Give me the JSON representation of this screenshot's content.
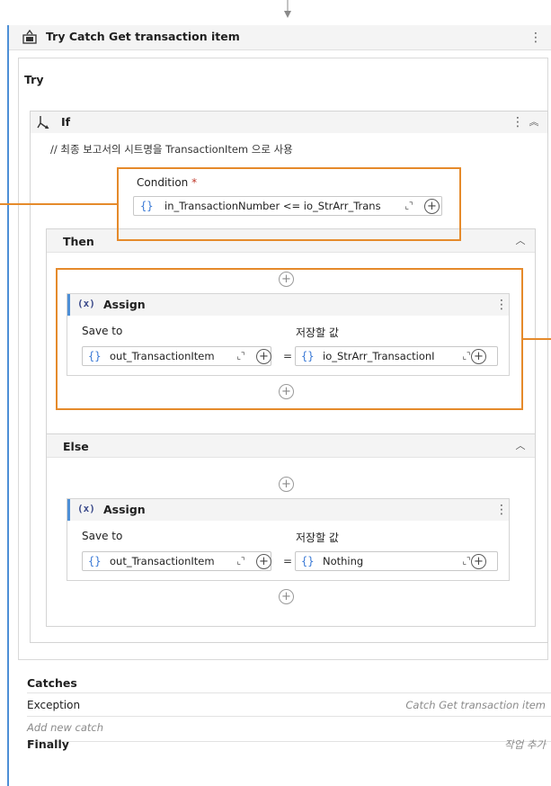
{
  "activity": {
    "title": "Try Catch Get transaction item",
    "try_label": "Try"
  },
  "if_block": {
    "label": "If",
    "comment": "// 최종 보고서의 시트명을 TransactionItem 으로 사용",
    "condition_label": "Condition",
    "condition_required_mark": "*",
    "condition_value": "in_TransactionNumber <= io_StrArr_Trans"
  },
  "then_branch": {
    "label": "Then",
    "assign": {
      "label": "Assign",
      "save_to_label": "Save to",
      "value_label": "저장할 값",
      "save_to_value": "out_TransactionItem",
      "value_value": "io_StrArr_TransactionI",
      "equals": "="
    }
  },
  "else_branch": {
    "label": "Else",
    "assign": {
      "label": "Assign",
      "save_to_label": "Save to",
      "value_label": "저장할 값",
      "save_to_value": "out_TransactionItem",
      "value_value": "Nothing",
      "equals": "="
    }
  },
  "catches": {
    "label": "Catches",
    "exception_label": "Exception",
    "exception_value": "Catch Get transaction item",
    "add_new_catch": "Add new catch"
  },
  "finally": {
    "label": "Finally",
    "add_activity": "작업 추가"
  },
  "icons": {
    "brace": "{}",
    "variable": "(x)",
    "expand": "expand-icon",
    "add": "plus-circle-icon",
    "kebab": "kebab-icon",
    "collapse": "chevron-up-icon"
  },
  "colors": {
    "highlight": "#e58a2b",
    "accent": "#4d8fd6",
    "required": "#c0392b"
  }
}
